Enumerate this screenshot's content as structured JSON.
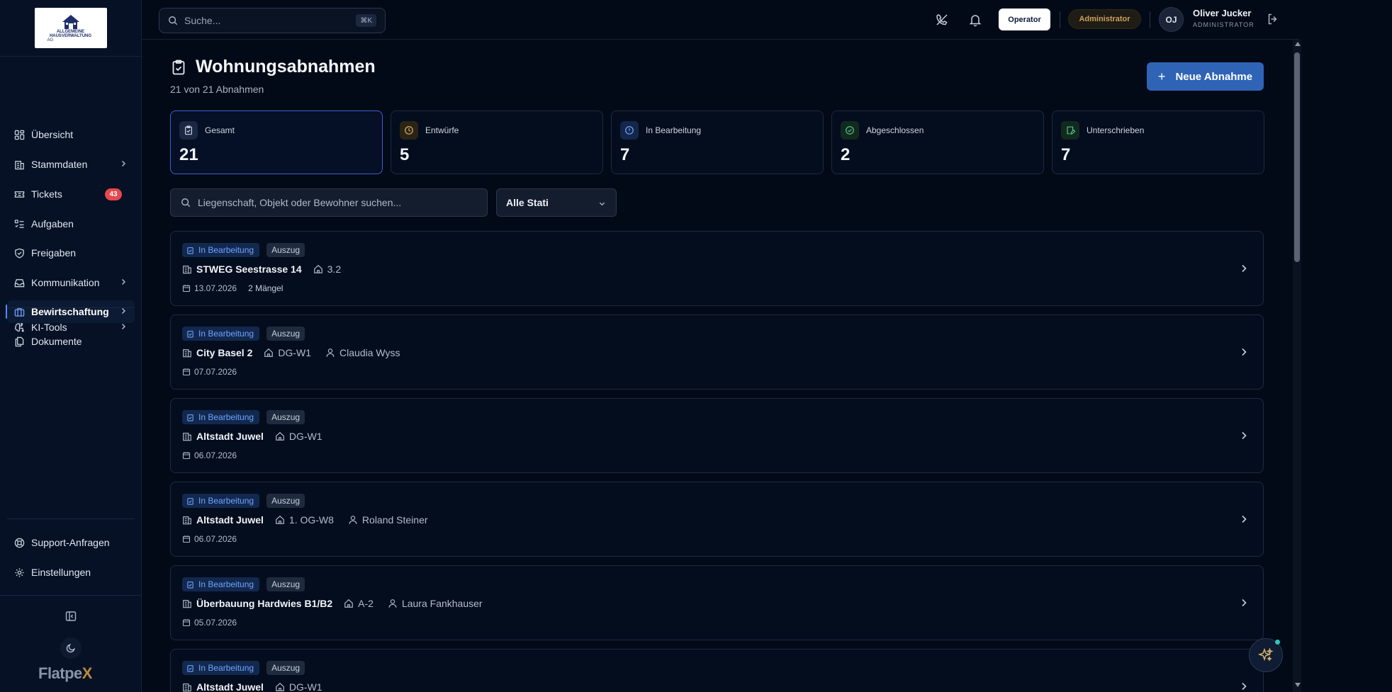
{
  "logo": {
    "line1": "ALLGEMEINE",
    "line2": "HAUSVERWALTUNG",
    "line3": "AG"
  },
  "sidebar": {
    "items": [
      {
        "label": "Übersicht",
        "icon": "dashboard-icon"
      },
      {
        "label": "Stammdaten",
        "icon": "building-icon",
        "chevron": true
      },
      {
        "label": "Tickets",
        "icon": "ticket-icon",
        "badge": "43"
      },
      {
        "label": "Aufgaben",
        "icon": "tasks-icon"
      },
      {
        "label": "Freigaben",
        "icon": "shield-check-icon"
      },
      {
        "label": "Kommunikation",
        "icon": "inbox-icon",
        "chevron": true
      },
      {
        "label": "Bewirtschaftung",
        "icon": "briefcase-icon",
        "chevron": true,
        "active": true
      },
      {
        "label": "Dokumente",
        "icon": "documents-icon"
      },
      {
        "label": "KI-Tools",
        "icon": "brain-icon",
        "chevron": true
      },
      {
        "label": "Support-Anfragen",
        "icon": "lifebuoy-icon"
      },
      {
        "label": "Einstellungen",
        "icon": "gear-icon"
      }
    ],
    "brand_main": "Flatpe",
    "brand_accent": "X"
  },
  "topbar": {
    "search_placeholder": "Suche...",
    "search_shortcut": "⌘K",
    "operator_label": "Operator",
    "admin_label": "Administrator",
    "avatar_initials": "OJ",
    "user_name": "Oliver Jucker",
    "user_role": "ADMINISTRATOR"
  },
  "page": {
    "title": "Wohnungsabnahmen",
    "subtitle": "21 von 21 Abnahmen",
    "new_button": "Neue Abnahme",
    "new_button_plus": "+"
  },
  "stats": [
    {
      "label": "Gesamt",
      "value": "21",
      "icon": "clipboard-icon",
      "color": "#6a7ba0"
    },
    {
      "label": "Entwürfe",
      "value": "5",
      "icon": "clock-icon",
      "color": "#c9a45c"
    },
    {
      "label": "In Bearbeitung",
      "value": "7",
      "icon": "info-circle-icon",
      "color": "#5b8ff0"
    },
    {
      "label": "Abgeschlossen",
      "value": "2",
      "icon": "check-circle-icon",
      "color": "#3fbf7f"
    },
    {
      "label": "Unterschrieben",
      "value": "7",
      "icon": "signed-doc-icon",
      "color": "#3fbf7f"
    }
  ],
  "filters": {
    "search_placeholder": "Liegenschaft, Objekt oder Bewohner suchen...",
    "status_selected": "Alle Stati"
  },
  "inspections": [
    {
      "status": "In Bearbeitung",
      "type": "Auszug",
      "property": "STWEG Seestrasse 14",
      "unit": "3.2",
      "person": "",
      "date": "13.07.2026",
      "defects": "2 Mängel"
    },
    {
      "status": "In Bearbeitung",
      "type": "Auszug",
      "property": "City Basel 2",
      "unit": "DG-W1",
      "person": "Claudia Wyss",
      "date": "07.07.2026",
      "defects": ""
    },
    {
      "status": "In Bearbeitung",
      "type": "Auszug",
      "property": "Altstadt Juwel",
      "unit": "DG-W1",
      "person": "",
      "date": "06.07.2026",
      "defects": ""
    },
    {
      "status": "In Bearbeitung",
      "type": "Auszug",
      "property": "Altstadt Juwel",
      "unit": "1. OG-W8",
      "person": "Roland Steiner",
      "date": "06.07.2026",
      "defects": ""
    },
    {
      "status": "In Bearbeitung",
      "type": "Auszug",
      "property": "Überbauung Hardwies B1/B2",
      "unit": "A-2",
      "person": "Laura Fankhauser",
      "date": "05.07.2026",
      "defects": ""
    },
    {
      "status": "In Bearbeitung",
      "type": "Auszug",
      "property": "Altstadt Juwel",
      "unit": "DG-W1",
      "person": "",
      "date": "",
      "defects": ""
    }
  ]
}
